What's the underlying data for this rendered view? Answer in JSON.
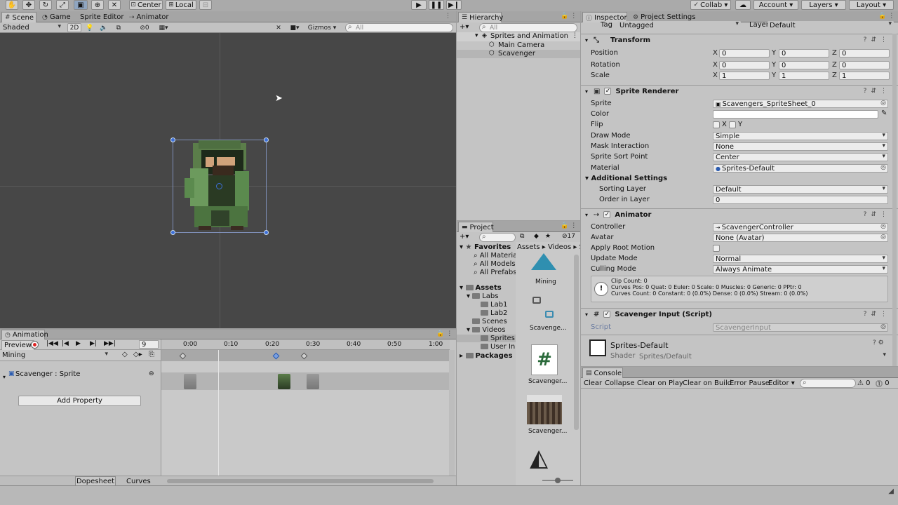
{
  "toolbar": {
    "pivot_label": "Center",
    "space_label": "Local",
    "collab_label": "Collab",
    "account_label": "Account",
    "layers_label": "Layers",
    "layout_label": "Layout"
  },
  "scene_tabs": [
    {
      "label": "Scene",
      "icon": "grid-icon"
    },
    {
      "label": "Game",
      "icon": "pacman-icon"
    },
    {
      "label": "Sprite Editor",
      "icon": ""
    },
    {
      "label": "Animator",
      "icon": "animator-icon"
    }
  ],
  "scene_toolbar": {
    "shading_mode": "Shaded",
    "mode_2d": "2D",
    "hidden_count": "0",
    "gizmos_label": "Gizmos",
    "search_placeholder": "All"
  },
  "animation": {
    "tab_label": "Animation",
    "preview_label": "Preview",
    "frame": "9",
    "clip_name": "Mining",
    "property_label": "Scavenger : Sprite",
    "add_property_label": "Add Property",
    "timeline_ticks": [
      "0:00",
      "0:10",
      "0:20",
      "0:30",
      "0:40",
      "0:50",
      "1:00"
    ],
    "bottom_tabs": [
      "Dopesheet",
      "Curves"
    ]
  },
  "hierarchy": {
    "tab_label": "Hierarchy",
    "search_placeholder": "All",
    "scene_name": "Sprites and Animation",
    "items": [
      {
        "label": "Main Camera"
      },
      {
        "label": "Scavenger"
      }
    ]
  },
  "project": {
    "tab_label": "Project",
    "hidden_count": "17",
    "favorites_label": "Favorites",
    "favorites": [
      "All Materia",
      "All Models",
      "All Prefabs"
    ],
    "assets_label": "Assets",
    "tree": [
      {
        "label": "Labs",
        "depth": 1
      },
      {
        "label": "Lab1",
        "depth": 2
      },
      {
        "label": "Lab2",
        "depth": 2
      },
      {
        "label": "Scenes",
        "depth": 1
      },
      {
        "label": "Videos",
        "depth": 1
      },
      {
        "label": "Sprites a",
        "depth": 2
      },
      {
        "label": "User Inp",
        "depth": 2
      }
    ],
    "packages_label": "Packages",
    "breadcrumb": [
      "Assets",
      "Videos",
      "S"
    ],
    "assets": [
      {
        "label": "Mining",
        "icon": "animation-clip-icon"
      },
      {
        "label": "Scavenge...",
        "icon": "animator-controller-icon"
      },
      {
        "label": "Scavenger...",
        "icon": "csharp-script-icon"
      },
      {
        "label": "Scavenger...",
        "icon": "spritesheet-icon"
      },
      {
        "label": "",
        "icon": "unity-scene-icon"
      }
    ]
  },
  "inspector": {
    "tabs": [
      "Inspector",
      "Project Settings"
    ],
    "tag_label": "Tag",
    "tag_value": "Untagged",
    "layer_label": "Layer",
    "layer_value": "Default",
    "transform": {
      "title": "Transform",
      "rows": [
        {
          "label": "Position",
          "x": "0",
          "y": "0",
          "z": "0"
        },
        {
          "label": "Rotation",
          "x": "0",
          "y": "0",
          "z": "0"
        },
        {
          "label": "Scale",
          "x": "1",
          "y": "1",
          "z": "1"
        }
      ]
    },
    "sprite_renderer": {
      "title": "Sprite Renderer",
      "sprite_label": "Sprite",
      "sprite_value": "Scavengers_SpriteSheet_0",
      "color_label": "Color",
      "flip_label": "Flip",
      "flip_x": "X",
      "flip_y": "Y",
      "draw_mode_label": "Draw Mode",
      "draw_mode_value": "Simple",
      "mask_label": "Mask Interaction",
      "mask_value": "None",
      "sort_point_label": "Sprite Sort Point",
      "sort_point_value": "Center",
      "material_label": "Material",
      "material_value": "Sprites-Default",
      "additional_label": "Additional Settings",
      "sorting_layer_label": "Sorting Layer",
      "sorting_layer_value": "Default",
      "order_label": "Order in Layer",
      "order_value": "0"
    },
    "animator": {
      "title": "Animator",
      "controller_label": "Controller",
      "controller_value": "ScavengerController",
      "avatar_label": "Avatar",
      "avatar_value": "None (Avatar)",
      "root_motion_label": "Apply Root Motion",
      "update_label": "Update Mode",
      "update_value": "Normal",
      "culling_label": "Culling Mode",
      "culling_value": "Always Animate",
      "info_lines": [
        "Clip Count: 0",
        "Curves Pos: 0 Quat: 0 Euler: 0 Scale: 0 Muscles: 0 Generic: 0 PPtr: 0",
        "Curves Count: 0 Constant: 0 (0.0%) Dense: 0 (0.0%) Stream: 0 (0.0%)"
      ]
    },
    "script_component": {
      "title": "Scavenger Input (Script)",
      "script_label": "Script",
      "script_value": "ScavengerInput"
    },
    "material_preview": {
      "name": "Sprites-Default",
      "shader_label": "Shader",
      "shader_value": "Sprites/Default"
    }
  },
  "console": {
    "tab_label": "Console",
    "buttons": [
      "Clear",
      "Collapse",
      "Clear on Play",
      "Clear on Build",
      "Error Pause",
      "Editor"
    ],
    "warn_count": "0",
    "error_count": "0"
  }
}
